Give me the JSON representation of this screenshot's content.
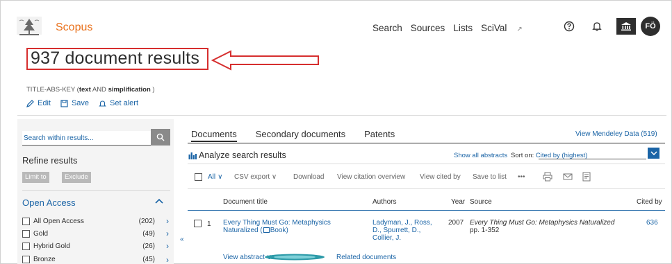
{
  "header": {
    "brand": "Scopus",
    "nav": [
      "Search",
      "Sources",
      "Lists",
      "SciVal"
    ],
    "nav_external_marker": "↗",
    "avatar_initials": "FÖ",
    "icons": [
      "help-icon",
      "bell-icon",
      "institution-icon"
    ]
  },
  "results": {
    "title": "937 document results",
    "query_prefix": "TITLE-ABS-KEY (",
    "query_term1": "text",
    "query_and": " AND ",
    "query_term2": "simplification",
    "query_suffix": " )",
    "actions": {
      "edit": "Edit",
      "save": "Save",
      "alert": "Set alert"
    }
  },
  "sidebar": {
    "search_placeholder": "Search within results...",
    "refine_title": "Refine results",
    "limit_to": "Limit to",
    "exclude": "Exclude",
    "open_access_title": "Open Access",
    "facets": [
      {
        "label": "All Open Access",
        "count": "(202)"
      },
      {
        "label": "Gold",
        "count": "(49)"
      },
      {
        "label": "Hybrid Gold",
        "count": "(26)"
      },
      {
        "label": "Bronze",
        "count": "(45)"
      }
    ]
  },
  "main": {
    "tabs": [
      "Documents",
      "Secondary documents",
      "Patents"
    ],
    "mendeley": "View Mendeley Data (519)",
    "analyze": "Analyze search results",
    "show_abstracts": "Show all abstracts",
    "sort_label": "Sort on:",
    "sort_value": "Cited by (highest)",
    "toolbar": {
      "all": "All",
      "csv": "CSV export",
      "download": "Download",
      "citation_overview": "View citation overview",
      "cited_by": "View cited by",
      "save_list": "Save to list",
      "more": "•••"
    },
    "columns": [
      "Document title",
      "Authors",
      "Year",
      "Source",
      "Cited by"
    ],
    "rows": [
      {
        "num": "1",
        "title_l1": "Every Thing Must Go: Metaphysics",
        "title_l2": "Naturalized (",
        "title_book": "Book)",
        "authors_l1": "Ladyman, J., Ross,",
        "authors_l2": "D., Spurrett, D.,",
        "authors_l3": "Collier, J.",
        "year": "2007",
        "source_l1": "Every Thing Must Go: Metaphysics Naturalized",
        "source_l2": "pp. 1-352",
        "cited": "636",
        "view_abstract": "View abstract",
        "related": "Related documents"
      }
    ]
  },
  "colors": {
    "brand": "#e9711c",
    "link": "#1a64a6",
    "highlight": "#d62e2e"
  }
}
